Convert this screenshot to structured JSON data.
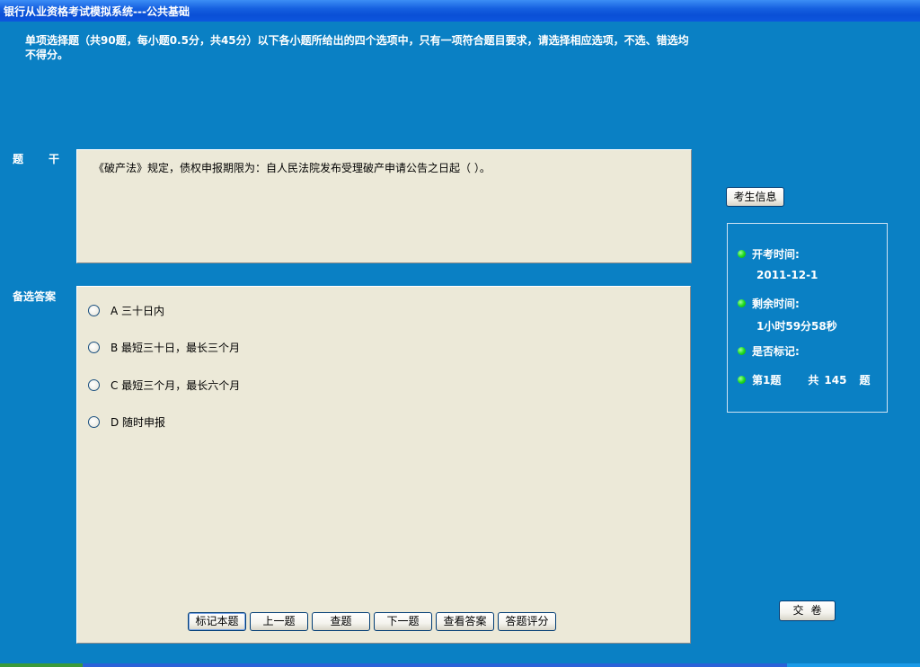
{
  "window": {
    "title": "银行从业资格考试模拟系统---公共基础"
  },
  "instructions": "单项选择题（共90题，每小题0.5分，共45分）以下各小题所给出的四个选项中，只有一项符合题目要求，请选择相应选项，不选、错选均不得分。",
  "labels": {
    "stem": "题干",
    "answers": "备选答案"
  },
  "question": {
    "stem": "《破产法》规定，债权申报期限为：自人民法院发布受理破产申请公告之日起（ ）。",
    "options": [
      "A 三十日内",
      "B 最短三十日，最长三个月",
      "C 最短三个月，最长六个月",
      "D 随时申报"
    ]
  },
  "buttons": {
    "mark": "标记本题",
    "prev": "上一题",
    "review": "查题",
    "next": "下一题",
    "view_answer": "查看答案",
    "score": "答题评分",
    "student_info": "考生信息",
    "submit": "交卷"
  },
  "info": {
    "start_time_label": "开考时间:",
    "start_time_value": "2011-12-1",
    "remaining_label": "剩余时间:",
    "remaining_value": "1小时59分58秒",
    "marked_label": "是否标记:",
    "question_index": "第1题",
    "total_prefix": "共",
    "total_count": "145",
    "total_suffix": "题"
  },
  "colors": {
    "background": "#0a80c4",
    "panel": "#ece9d8",
    "indicator": "#22dd22"
  }
}
